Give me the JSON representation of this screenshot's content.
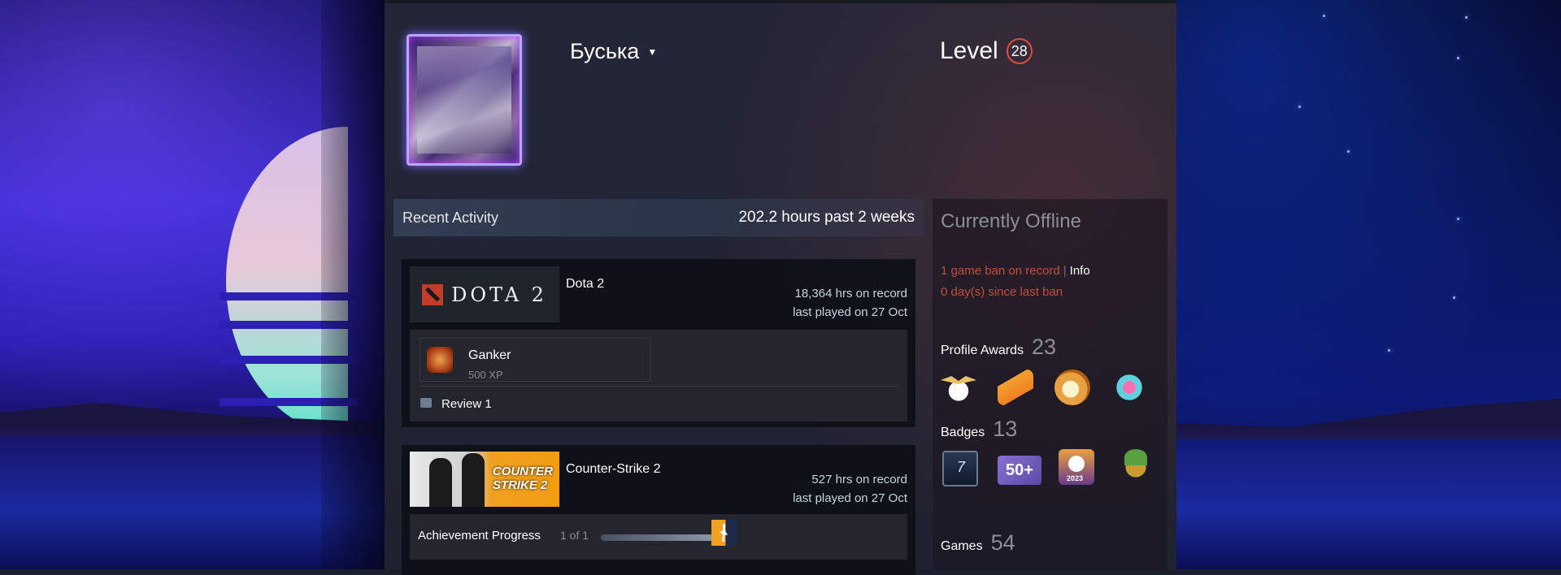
{
  "profile": {
    "persona_name": "Буська",
    "level_label": "Level",
    "level_value": "28"
  },
  "recent_activity": {
    "title": "Recent Activity",
    "hours_summary": "202.2 hours past 2 weeks"
  },
  "games_list": [
    {
      "name": "Dota 2",
      "capsule_text": "DOTA 2",
      "hours_on_record": "18,364 hrs on record",
      "last_played": "last played on 27 Oct",
      "achievement_name": "Ganker",
      "achievement_xp": "500 XP",
      "review_label": "Review 1"
    },
    {
      "name": "Counter-Strike 2",
      "capsule_text_line1": "COUNTER",
      "capsule_text_line2": "STRIKE 2",
      "hours_on_record": "527 hrs on record",
      "last_played": "last played on 27 Oct",
      "achievement_progress_label": "Achievement Progress",
      "achievement_progress_value": "1 of 1",
      "achievement_progress_fraction": 1.0
    }
  ],
  "sidebar": {
    "status": "Currently Offline",
    "ban_text": "1 game ban on record",
    "ban_info_link": "Info",
    "ban_days": "0 day(s) since last ban",
    "profile_awards_label": "Profile Awards",
    "profile_awards_count": "23",
    "badges_label": "Badges",
    "badges_count": "13",
    "badge_50_label": "50+",
    "badge_2023_label": "2023",
    "games_label": "Games",
    "games_count": "54"
  },
  "colors": {
    "ban_red": "#c0503a",
    "level_ring": "#e04a3a",
    "panel_dark": "#0c0e14"
  }
}
